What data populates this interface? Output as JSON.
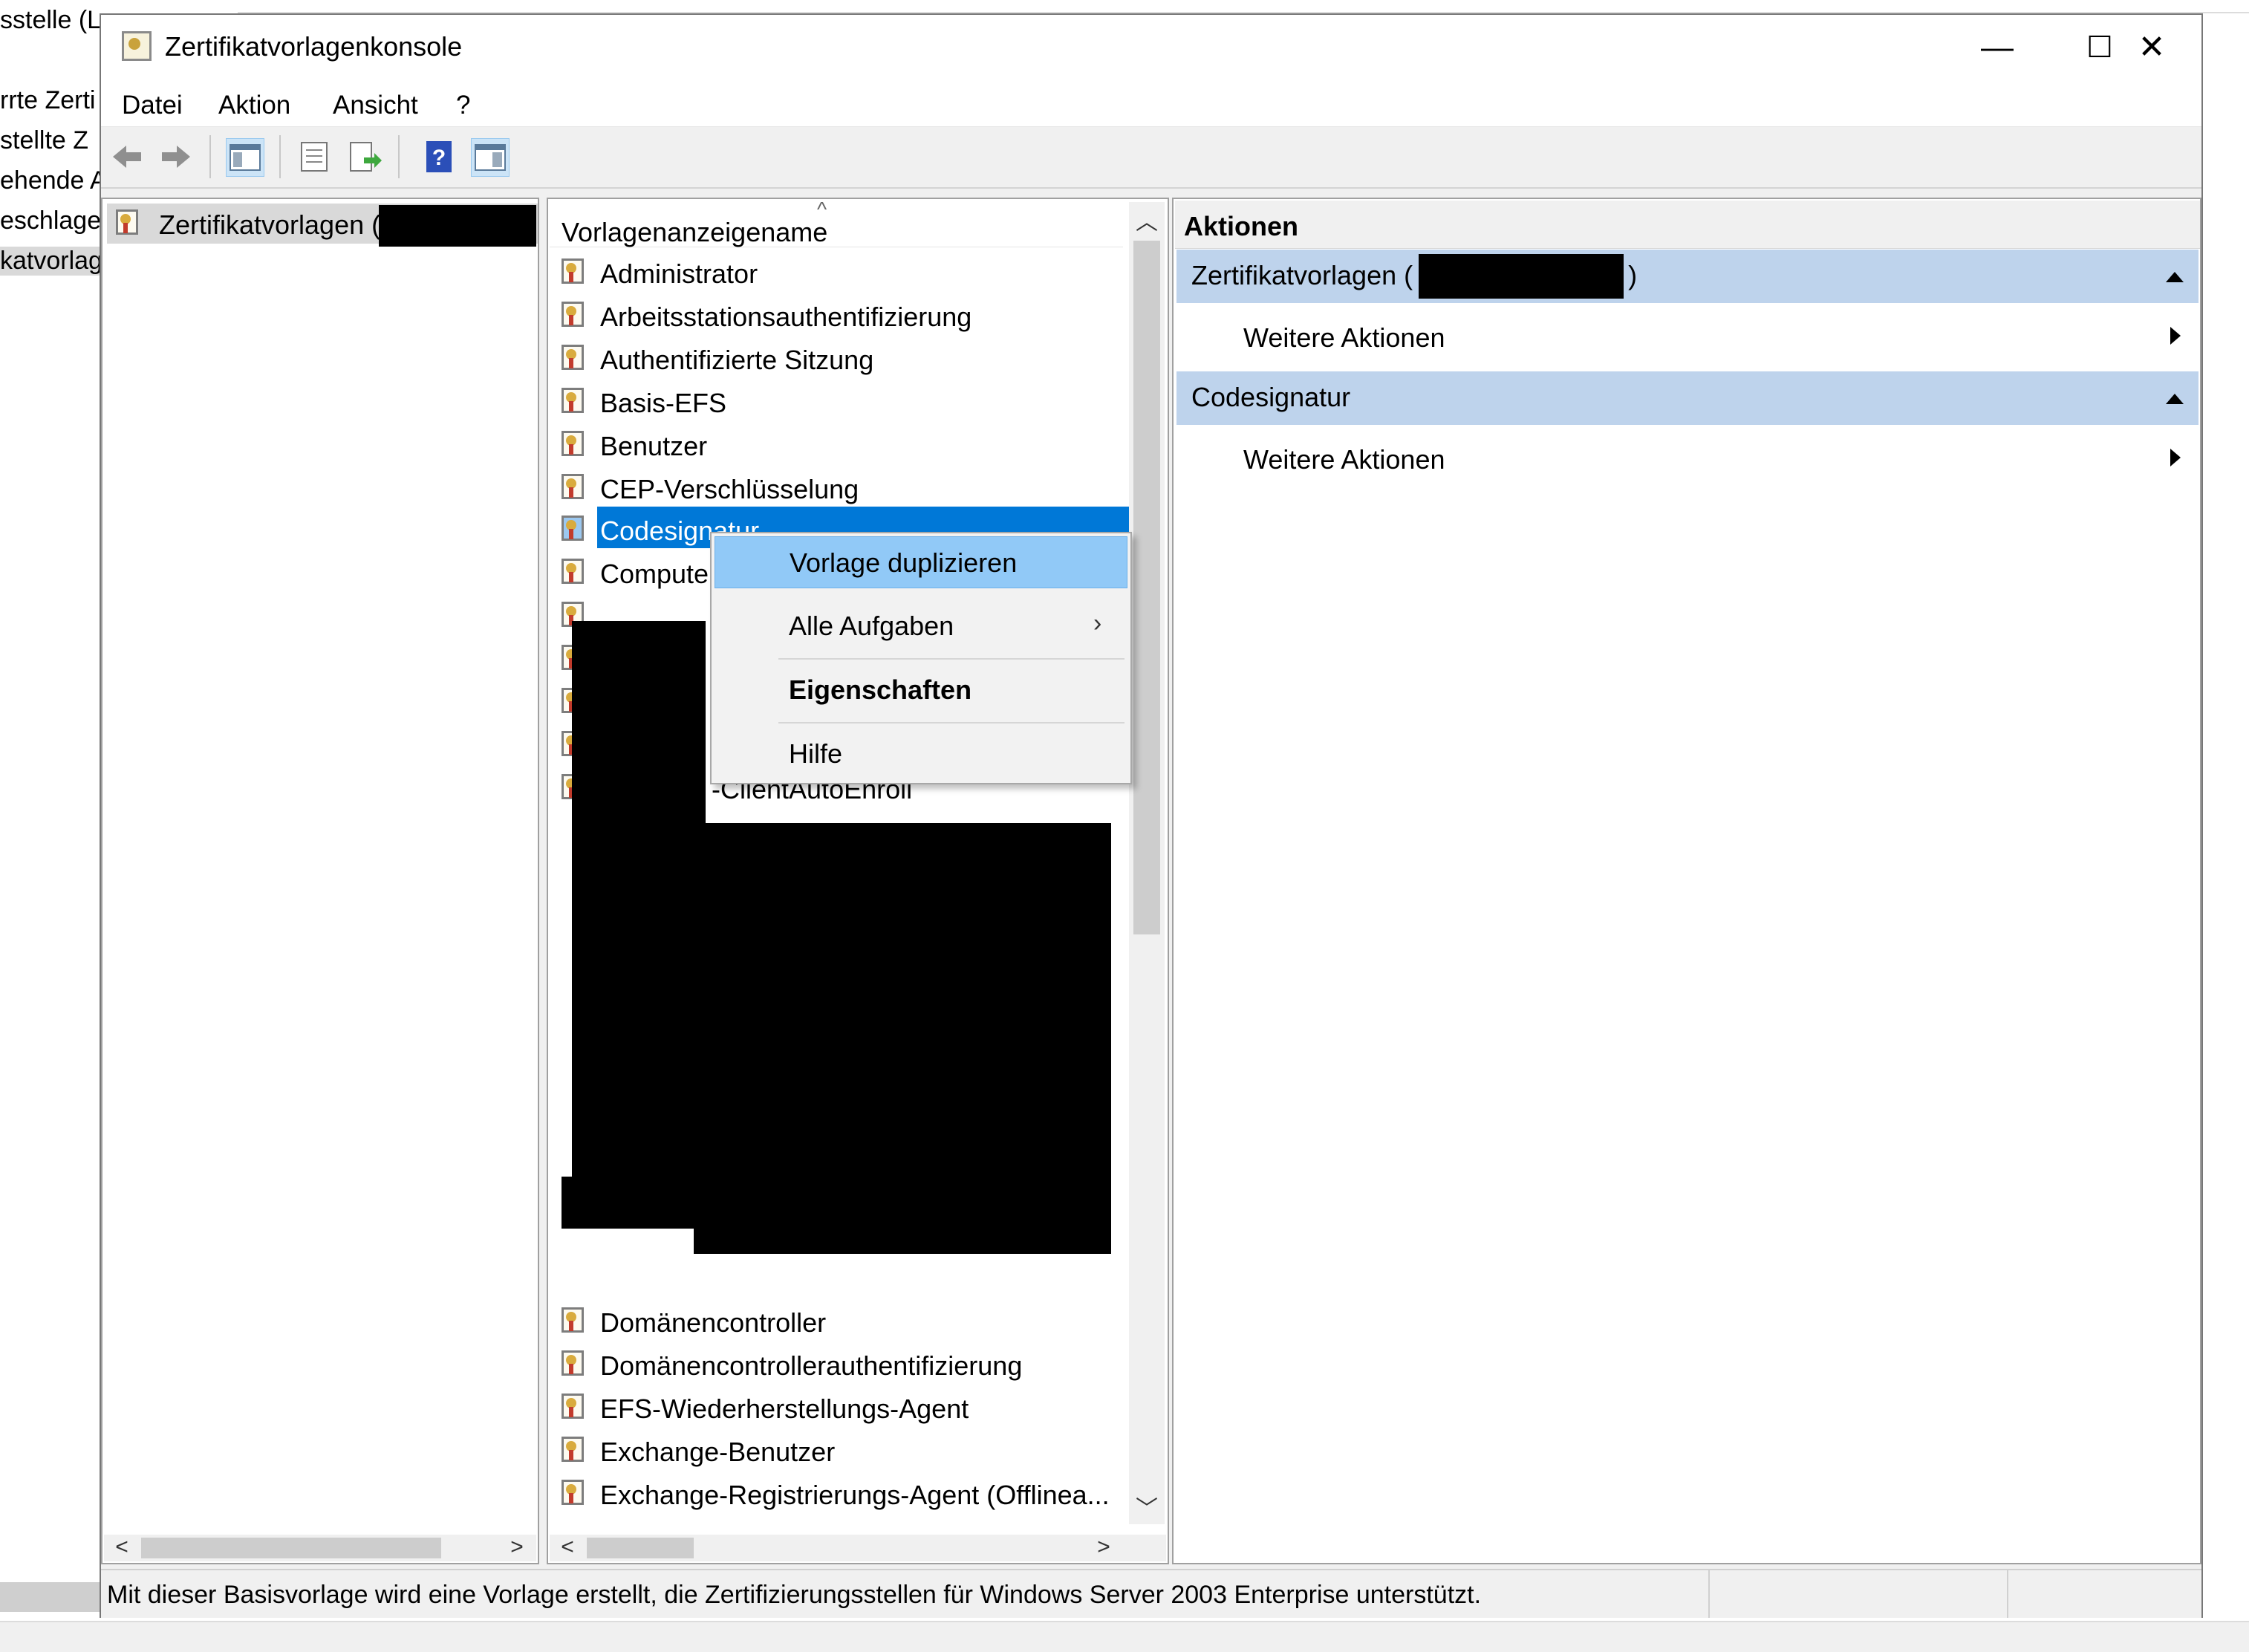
{
  "background_window": {
    "partial_labels": [
      "sstelle (L",
      "rrte Zerti",
      "stellte Z",
      "ehende A",
      "eschlage",
      "katvorlag"
    ]
  },
  "window": {
    "title": "Zertifikatvorlagenkonsole",
    "controls": {
      "minimize": "—",
      "maximize": "☐",
      "close": "✕"
    }
  },
  "menubar": {
    "items": [
      "Datei",
      "Aktion",
      "Ansicht",
      "?"
    ]
  },
  "toolbar": {
    "buttons": [
      "back-icon",
      "forward-icon",
      "show-hide-tree-icon",
      "properties-icon",
      "export-list-icon",
      "help-icon",
      "show-hide-action-pane-icon"
    ]
  },
  "tree": {
    "root_label": "Zertifikatvorlagen ("
  },
  "list": {
    "column_header": "Vorlagenanzeigename",
    "sort_indicator": "^",
    "items_top": [
      "Administrator",
      "Arbeitsstationsauthentifizierung",
      "Authentifizierte Sitzung",
      "Basis-EFS",
      "Benutzer",
      "CEP-Verschlüsselung",
      "Codesignatur",
      "Compute"
    ],
    "selected_index": 6,
    "partial_visible_text": "-ClientAutoEnroll",
    "items_bottom": [
      "Domänencontroller",
      "Domänencontrollerauthentifizierung",
      "EFS-Wiederherstellungs-Agent",
      "Exchange-Benutzer",
      "Exchange-Registrierungs-Agent (Offlinea..."
    ]
  },
  "actions": {
    "header": "Aktionen",
    "groups": [
      {
        "title": "Zertifikatvorlagen (",
        "title_suffix": ")",
        "item": "Weitere Aktionen"
      },
      {
        "title": "Codesignatur",
        "title_suffix": "",
        "item": "Weitere Aktionen"
      }
    ]
  },
  "context_menu": {
    "items": [
      {
        "label": "Vorlage duplizieren",
        "highlighted": true
      },
      {
        "label": "Alle Aufgaben",
        "submenu": true
      },
      {
        "label": "Eigenschaften",
        "bold": true
      },
      {
        "label": "Hilfe"
      }
    ]
  },
  "statusbar": {
    "text": "Mit dieser Basisvorlage wird eine Vorlage erstellt, die Zertifizierungsstellen für Windows Server 2003 Enterprise unterstützt."
  },
  "colors": {
    "selection": "#0078d7",
    "menu_highlight": "#91c9f7",
    "action_header": "#bed3ec"
  }
}
